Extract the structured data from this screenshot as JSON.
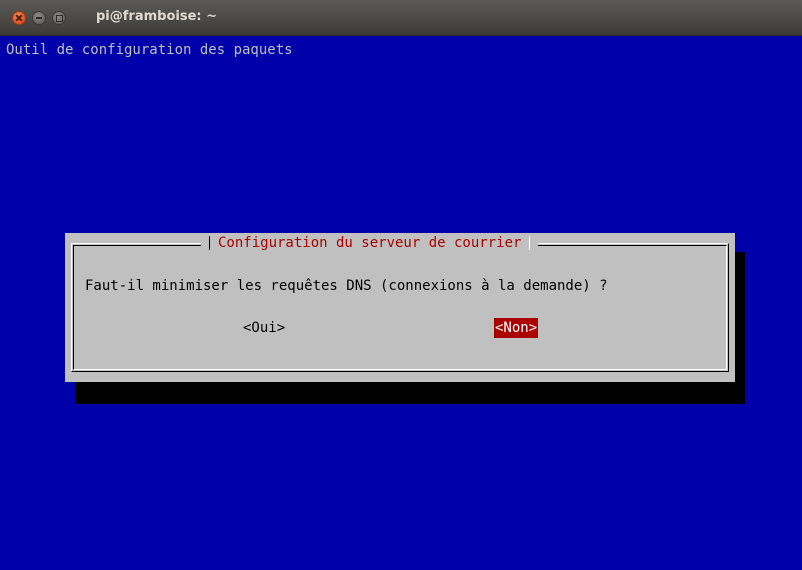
{
  "window": {
    "title": "pi@framboise: ~"
  },
  "terminal": {
    "backtitle": "Outil de configuration des paquets"
  },
  "dialog": {
    "title": "Configuration du serveur de courrier",
    "question": "Faut-il minimiser les requêtes DNS (connexions à la demande) ?",
    "buttons": {
      "yes": "<Oui>",
      "no": "<Non>"
    },
    "selected_button": "no"
  },
  "colors": {
    "background": "#0000aa",
    "dialog": "#c0c0c0",
    "accent": "#aa0000",
    "shadow": "#000000"
  }
}
